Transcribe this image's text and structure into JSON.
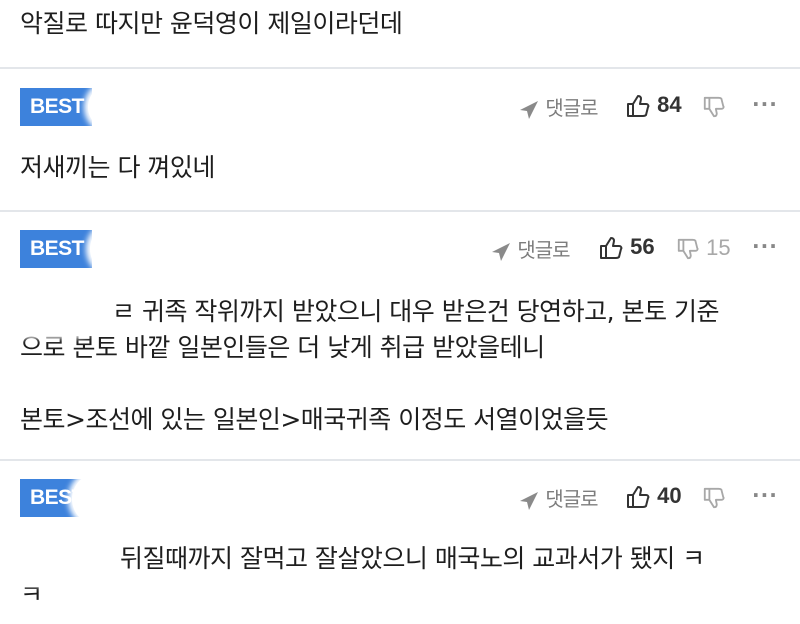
{
  "comments": [
    {
      "text": "악질로 따지만 윤덕영이 제일이라던데"
    },
    {
      "badge": "BEST",
      "reply_label": "댓글로",
      "likes": "84",
      "dislikes": "",
      "more": "···",
      "text": "저새끼는 다 껴있네"
    },
    {
      "badge": "BEST",
      "reply_label": "댓글로",
      "likes": "56",
      "dislikes": "15",
      "more": "···",
      "text": "ㄹ 귀족 작위까지 받았으니 대우 받은건 당연하고, 본토 기준\n으로 본토 바깥 일본인들은 더 낮게 취급 받았을테니\n\n본토>조선에 있는 일본인>매국귀족 이정도 서열이었을듯"
    },
    {
      "badge": "BEST",
      "reply_label": "댓글로",
      "likes": "40",
      "dislikes": "",
      "more": "···",
      "text": "뒤질때까지 잘먹고 잘살았으니 매국노의 교과서가 됐지 ㅋ\nㅋ"
    }
  ]
}
